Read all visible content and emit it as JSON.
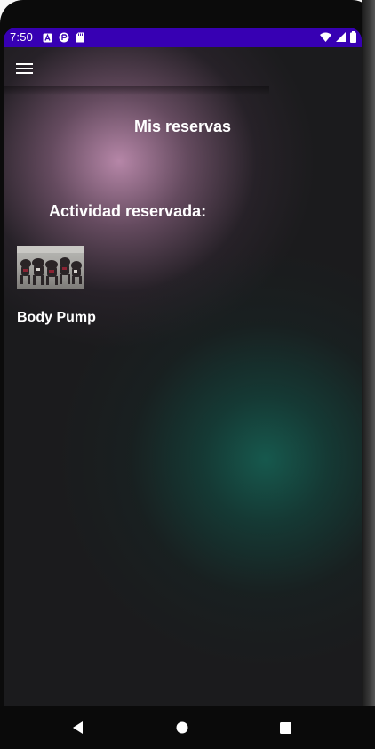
{
  "status_bar": {
    "time": "7:50",
    "left_icons": [
      "font-icon",
      "game-icon",
      "sd-card-icon"
    ],
    "right_icons": [
      "wifi-icon",
      "signal-icon",
      "battery-icon"
    ],
    "color": "#3700b3"
  },
  "app_bar": {
    "menu_icon": "hamburger-menu-icon"
  },
  "page": {
    "title": "Mis reservas",
    "section_label": "Actividad reservada:",
    "activity": {
      "name": "Body Pump",
      "thumbnail": "group-fitness-class-photo"
    }
  },
  "nav_bar": {
    "buttons": [
      "back-icon",
      "home-icon",
      "recents-icon"
    ]
  },
  "colors": {
    "background": "#1b1b1d",
    "glow_pink": "#be8caf",
    "glow_teal": "#165c50",
    "text": "#ffffff"
  }
}
